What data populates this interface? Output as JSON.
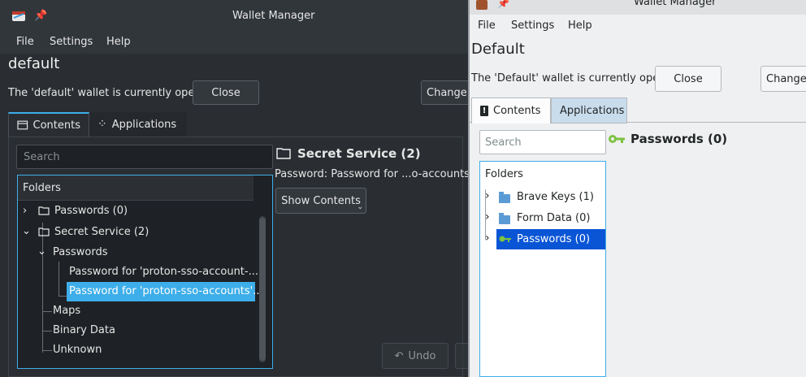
{
  "dark_window": {
    "title": "Wallet Manager",
    "menu": [
      "File",
      "Settings",
      "Help"
    ],
    "wallet_name": "default",
    "status_text": "The 'default' wallet is currently open",
    "close_label": "Close",
    "change_label": "Change",
    "tabs": [
      {
        "label": "Contents"
      },
      {
        "label": "Applications"
      }
    ],
    "search_placeholder": "Search",
    "tree_header": "Folders",
    "tree": {
      "passwords": "Passwords (0)",
      "secret_service": "Secret Service (2)",
      "sub_passwords": "Passwords",
      "entry1": "Password for 'proton-sso-account-...",
      "entry2": "Password for 'proton-sso-accounts'...",
      "maps": "Maps",
      "binary": "Binary Data",
      "unknown": "Unknown"
    },
    "detail_title": "Secret Service (2)",
    "detail_text": "Password: Password for ...o-accounts' o",
    "show_contents_label": "Show Contents",
    "undo_label": "Undo"
  },
  "light_window": {
    "title": "Wallet Manager",
    "menu": [
      "File",
      "Settings",
      "Help"
    ],
    "wallet_name": "Default",
    "status_text": "The 'Default' wallet is currently open",
    "close_label": "Close",
    "change_label": "Change",
    "tabs": [
      {
        "label": "Contents"
      },
      {
        "label": "Applications"
      }
    ],
    "search_placeholder": "Search",
    "tree_header": "Folders",
    "tree": [
      {
        "label": "Brave Keys (1)"
      },
      {
        "label": "Form Data (0)"
      },
      {
        "label": "Passwords (0)"
      }
    ],
    "detail_title": "Passwords (0)"
  },
  "colors": {
    "accent": "#3daee9",
    "dark_bg": "#2a2e32",
    "light_bg": "#eff0f1"
  }
}
